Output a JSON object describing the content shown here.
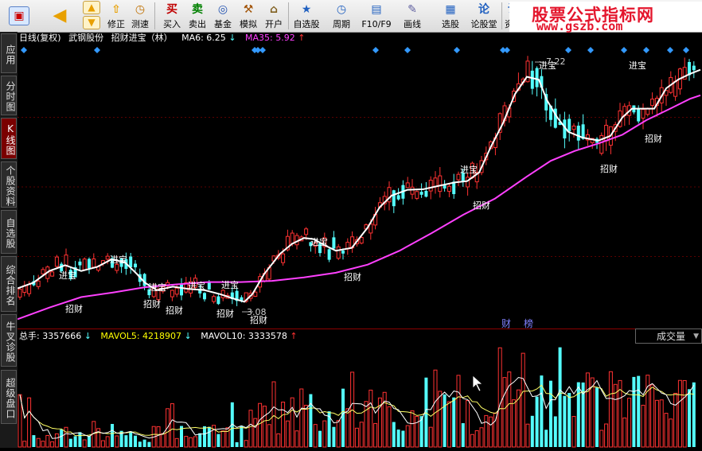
{
  "toolbar": {
    "buttons": [
      {
        "label": "修正",
        "icon": "⇧"
      },
      {
        "label": "测速",
        "icon": "◷"
      },
      {
        "label": "买入",
        "icon": "买"
      },
      {
        "label": "卖出",
        "icon": "卖"
      },
      {
        "label": "基金",
        "icon": "◎"
      },
      {
        "label": "模拟",
        "icon": "⚒"
      },
      {
        "label": "开户",
        "icon": "⌂"
      },
      {
        "label": "自选股",
        "icon": "★"
      },
      {
        "label": "周期",
        "icon": "◷"
      },
      {
        "label": "F10/F9",
        "icon": "▤"
      },
      {
        "label": "画线",
        "icon": "✎"
      },
      {
        "label": "选股",
        "icon": "▦"
      },
      {
        "label": "论股堂",
        "icon": "论"
      },
      {
        "label": "资讯",
        "icon": "讯"
      }
    ]
  },
  "watermark": {
    "title": "股票公式指标网",
    "url": "www.gszb.com"
  },
  "left_tabs": [
    "应用",
    "分时图",
    "K线图",
    "个股资料",
    "自选股",
    "综合排名",
    "牛叉诊股",
    "超级盘口"
  ],
  "price_panel": {
    "period": "日线(复权)",
    "stock": "武钢股份",
    "indicator": "招财进宝（林）",
    "ma6_label": "MA6: 6.25",
    "ma6_arrow": "↓",
    "ma35_label": "MA35: 5.92",
    "ma35_arrow": "↑",
    "high_label": "7.22",
    "low_label": "3.08",
    "buy_signal": "进宝",
    "sell_signal": "招财",
    "event_labels": [
      "财",
      "榜"
    ]
  },
  "volume_panel": {
    "total_label": "总手: 3357666",
    "total_arrow": "↓",
    "mavol5_label": "MAVOL5: 4218907",
    "mavol5_arrow": "↓",
    "mavol10_label": "MAVOL10: 3333578",
    "mavol10_arrow": "↑",
    "selector": "成交量"
  },
  "colors": {
    "up": "#ff3232",
    "down": "#54ffff",
    "ma6": "#ffffff",
    "ma35": "#ff40ff",
    "mavol5": "#ffffff",
    "mavol10": "#ffff66",
    "signal_marker": "#3399ff",
    "info_text": "#ffffff",
    "mavol5_text": "#ffff00",
    "ma35_text": "#ff40ff"
  },
  "chart_data": {
    "type": "candlestick",
    "price_ylim": [
      2.8,
      7.6
    ],
    "ma6_points": [
      [
        0,
        3.45
      ],
      [
        20,
        3.55
      ],
      [
        40,
        3.75
      ],
      [
        60,
        3.85
      ],
      [
        80,
        3.75
      ],
      [
        100,
        3.82
      ],
      [
        118,
        3.95
      ],
      [
        135,
        3.9
      ],
      [
        150,
        3.7
      ],
      [
        160,
        3.55
      ],
      [
        175,
        3.42
      ],
      [
        195,
        3.48
      ],
      [
        215,
        3.44
      ],
      [
        235,
        3.42
      ],
      [
        255,
        3.35
      ],
      [
        270,
        3.28
      ],
      [
        285,
        3.22
      ],
      [
        295,
        3.35
      ],
      [
        310,
        3.7
      ],
      [
        330,
        4.05
      ],
      [
        345,
        4.22
      ],
      [
        360,
        4.32
      ],
      [
        372,
        4.3
      ],
      [
        385,
        4.2
      ],
      [
        400,
        4.1
      ],
      [
        420,
        4.15
      ],
      [
        440,
        4.5
      ],
      [
        455,
        4.85
      ],
      [
        470,
        5.05
      ],
      [
        490,
        5.15
      ],
      [
        510,
        5.16
      ],
      [
        530,
        5.22
      ],
      [
        550,
        5.28
      ],
      [
        565,
        5.3
      ],
      [
        580,
        5.45
      ],
      [
        595,
        5.9
      ],
      [
        610,
        6.3
      ],
      [
        625,
        6.8
      ],
      [
        640,
        7.1
      ],
      [
        655,
        7.05
      ],
      [
        665,
        6.7
      ],
      [
        678,
        6.4
      ],
      [
        692,
        6.15
      ],
      [
        710,
        6.05
      ],
      [
        730,
        6.0
      ],
      [
        745,
        6.08
      ],
      [
        760,
        6.4
      ],
      [
        772,
        6.55
      ],
      [
        785,
        6.55
      ],
      [
        800,
        6.55
      ],
      [
        815,
        6.9
      ],
      [
        830,
        7.05
      ],
      [
        845,
        7.15
      ],
      [
        858,
        7.22
      ]
    ],
    "ma35_points": [
      [
        0,
        2.92
      ],
      [
        40,
        3.12
      ],
      [
        80,
        3.3
      ],
      [
        120,
        3.38
      ],
      [
        160,
        3.47
      ],
      [
        200,
        3.52
      ],
      [
        240,
        3.56
      ],
      [
        280,
        3.56
      ],
      [
        320,
        3.58
      ],
      [
        360,
        3.64
      ],
      [
        400,
        3.72
      ],
      [
        440,
        3.86
      ],
      [
        480,
        4.1
      ],
      [
        520,
        4.4
      ],
      [
        560,
        4.72
      ],
      [
        600,
        5.0
      ],
      [
        640,
        5.38
      ],
      [
        670,
        5.65
      ],
      [
        700,
        5.82
      ],
      [
        730,
        5.95
      ],
      [
        760,
        6.1
      ],
      [
        790,
        6.35
      ],
      [
        820,
        6.55
      ],
      [
        845,
        6.72
      ],
      [
        858,
        6.78
      ]
    ],
    "volume_ylim": [
      0,
      14000000
    ]
  }
}
